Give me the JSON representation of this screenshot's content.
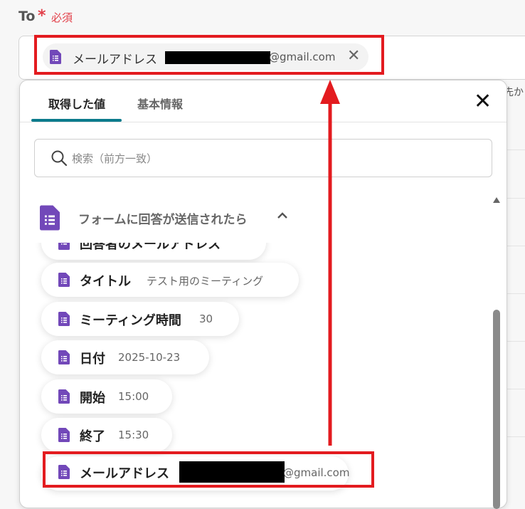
{
  "field": {
    "label": "To",
    "required_mark": "*",
    "required_text": "必須",
    "chip_label": "メールアドレス",
    "chip_domain": "@gmail.com",
    "side_text": "先か"
  },
  "panel": {
    "tabs": [
      {
        "label": "取得した値",
        "active": true
      },
      {
        "label": "基本情報",
        "active": false
      }
    ],
    "search_placeholder": "検索（前方一致）",
    "group_title": "フォームに回答が送信されたら",
    "items": [
      {
        "label": "回答者のメールアドレス",
        "value": ""
      },
      {
        "label": "タイトル",
        "value": "テスト用のミーティング"
      },
      {
        "label": "ミーティング時間",
        "value": "30"
      },
      {
        "label": "日付",
        "value": "2025-10-23"
      },
      {
        "label": "開始",
        "value": "15:00"
      },
      {
        "label": "終了",
        "value": "15:30"
      },
      {
        "label": "メールアドレス",
        "value": "@gmail.com"
      }
    ]
  },
  "colors": {
    "accent_tab": "#0b7b8c",
    "highlight_red": "#e31b1f",
    "required_red": "#e2404a",
    "doc_icon_purple": "#7248b9"
  }
}
